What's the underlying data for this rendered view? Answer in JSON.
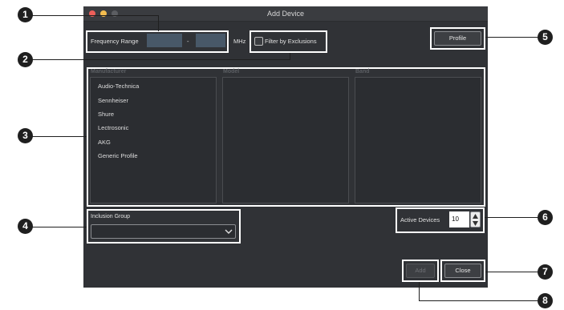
{
  "window": {
    "title": "Add Device"
  },
  "frequency": {
    "label": "Frequency Range",
    "from_value": "",
    "separator": "-",
    "to_value": "",
    "unit": "MHz"
  },
  "filter": {
    "label": "Filter by Exclusions",
    "checked": false
  },
  "profile_button": "Profile",
  "columns": {
    "manufacturer": "Manufacturer",
    "model": "Model",
    "band": "Band"
  },
  "manufacturers": [
    "Audio-Technica",
    "Sennheiser",
    "Shure",
    "Lectrosonic",
    "AKG",
    "Generic Profile"
  ],
  "inclusion_group": {
    "label": "Inclusion Group",
    "value": ""
  },
  "active_devices": {
    "label": "Active Devices",
    "value": "10"
  },
  "buttons": {
    "add": "Add",
    "close": "Close"
  },
  "callouts": [
    "1",
    "2",
    "3",
    "4",
    "5",
    "6",
    "7",
    "8"
  ]
}
